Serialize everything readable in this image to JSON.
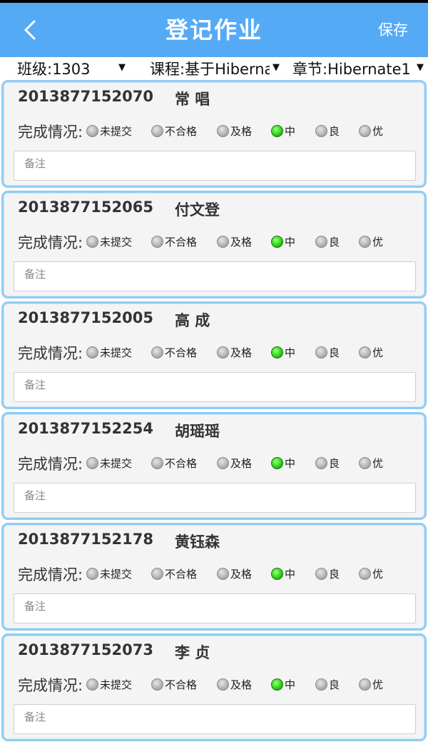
{
  "header": {
    "title": "登记作业",
    "save_label": "保存",
    "back_icon": "chevron-left-icon",
    "color": "#55aaf5"
  },
  "filters": {
    "class": "班级:1303",
    "course": "课程:基于Hibernate",
    "chapter": "章节:Hibernate1",
    "arrow": "▼"
  },
  "status_label": "完成情况:",
  "options": [
    "未提交",
    "不合格",
    "及格",
    "中",
    "良",
    "优"
  ],
  "note_placeholder": "备注",
  "students": [
    {
      "id": "2013877152070",
      "name": "常 唱",
      "selected": "中"
    },
    {
      "id": "2013877152065",
      "name": "付文登",
      "selected": "中"
    },
    {
      "id": "2013877152005",
      "name": "高 成",
      "selected": "中"
    },
    {
      "id": "2013877152254",
      "name": "胡瑶瑶",
      "selected": "中"
    },
    {
      "id": "2013877152178",
      "name": "黄钰森",
      "selected": "中"
    },
    {
      "id": "2013877152073",
      "name": "李 贞",
      "selected": "中"
    }
  ]
}
